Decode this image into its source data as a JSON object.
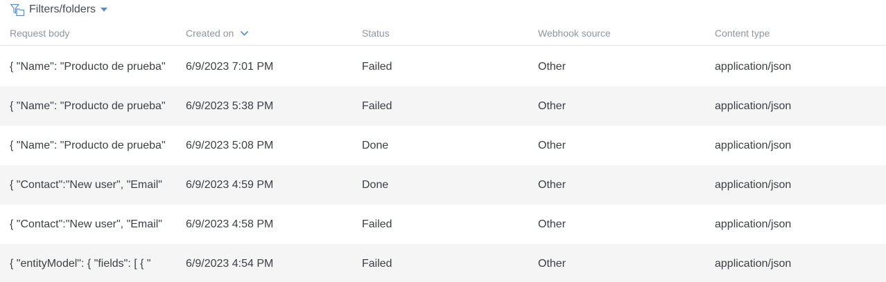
{
  "filters": {
    "label": "Filters/folders",
    "icon": "filter-folder-icon"
  },
  "columns": {
    "request_body": "Request body",
    "created_on": "Created on",
    "status": "Status",
    "webhook_source": "Webhook source",
    "content_type": "Content type"
  },
  "sort": {
    "column": "created_on",
    "direction": "descending"
  },
  "rows": [
    {
      "request_body": "{ \"Name\": \"Producto de prueba\"",
      "created_on": "6/9/2023 7:01 PM",
      "status": "Failed",
      "webhook_source": "Other",
      "content_type": "application/json"
    },
    {
      "request_body": "{ \"Name\": \"Producto de prueba\"",
      "created_on": "6/9/2023 5:38 PM",
      "status": "Failed",
      "webhook_source": "Other",
      "content_type": "application/json"
    },
    {
      "request_body": "{ \"Name\": \"Producto de prueba\"",
      "created_on": "6/9/2023 5:08 PM",
      "status": "Done",
      "webhook_source": "Other",
      "content_type": "application/json"
    },
    {
      "request_body": "{ \"Contact\":\"New user\", \"Email\"",
      "created_on": "6/9/2023 4:59 PM",
      "status": "Done",
      "webhook_source": "Other",
      "content_type": "application/json"
    },
    {
      "request_body": "{ \"Contact\":\"New user\", \"Email\"",
      "created_on": "6/9/2023 4:58 PM",
      "status": "Failed",
      "webhook_source": "Other",
      "content_type": "application/json"
    },
    {
      "request_body": "{ \"entityModel\": { \"fields\": [ { \"",
      "created_on": "6/9/2023 4:54 PM",
      "status": "Failed",
      "webhook_source": "Other",
      "content_type": "application/json"
    }
  ],
  "colors": {
    "accent": "#5b8ec6",
    "header_text": "#8c96a0",
    "cell_text": "#3a3f45",
    "row_alt_bg": "#f5f5f5",
    "header_border": "#e1e5ea"
  }
}
